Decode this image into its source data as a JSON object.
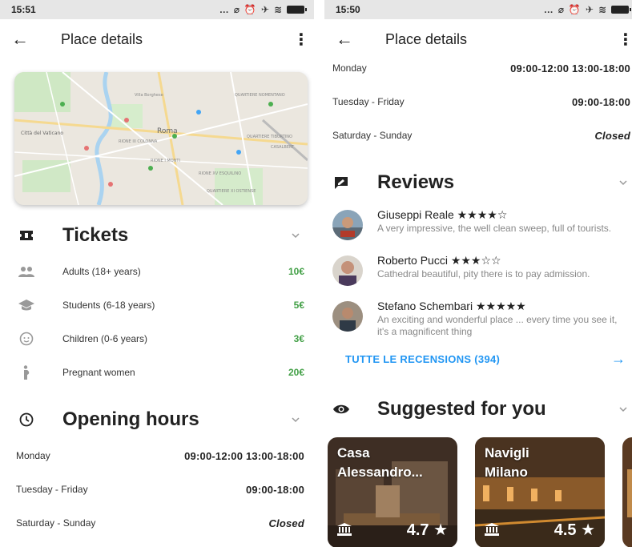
{
  "left": {
    "status_time": "15:51",
    "title": "Place details",
    "tickets": {
      "title": "Tickets",
      "rows": [
        {
          "label": "Adults (18+ years)",
          "price": "10€"
        },
        {
          "label": "Students (6-18 years)",
          "price": "5€"
        },
        {
          "label": "Children (0-6 years)",
          "price": "3€"
        },
        {
          "label": "Pregnant women",
          "price": "20€"
        }
      ]
    },
    "hours": {
      "title": "Opening hours",
      "rows": [
        {
          "day": "Monday",
          "time": "09:00-12:00 13:00-18:00"
        },
        {
          "day": "Tuesday - Friday",
          "time": "09:00-18:00"
        },
        {
          "day": "Saturday - Sunday",
          "time": "Closed"
        }
      ]
    },
    "map_labels": [
      "Roma",
      "Città del Vaticano",
      "QUARTIERE XI OSTIENSE",
      "RIONE I MONTI",
      "CASALBERT",
      "QUARTIERE NOMENTANO",
      "QUARTIERE TIBURTINO",
      "RIONE XV ESQUILINO",
      "RIONE III COLONNA",
      "Villa Borghese"
    ]
  },
  "right": {
    "status_time": "15:50",
    "title": "Place details",
    "hours": [
      {
        "day": "Monday",
        "time": "09:00-12:00 13:00-18:00"
      },
      {
        "day": "Tuesday - Friday",
        "time": "09:00-18:00"
      },
      {
        "day": "Saturday - Sunday",
        "time": "Closed"
      }
    ],
    "reviews": {
      "title": "Reviews",
      "items": [
        {
          "name": "Giuseppi Reale",
          "stars": "★★★★☆",
          "text": "A very impressive, the well clean sweep, full of tourists."
        },
        {
          "name": "Roberto Pucci",
          "stars": "★★★☆☆",
          "text": "Cathedral beautiful, pity there is to pay admission."
        },
        {
          "name": "Stefano Schembari",
          "stars": "★★★★★",
          "text": "An exciting and wonderful place ... every time you see it, it's a magnificent thing"
        }
      ],
      "all_link": "TUTTE LE RECENSIONS (394)",
      "arrow": "→"
    },
    "suggested": {
      "title": "Suggested for you",
      "cards": [
        {
          "name_line1": "Casa",
          "name_line2": "Alessandro...",
          "rating": "4.7 ★"
        },
        {
          "name_line1": "Navigli",
          "name_line2": "Milano",
          "rating": "4.5 ★"
        }
      ]
    }
  },
  "colors": {
    "accent": "#2196f3",
    "price": "#43a047",
    "status_bar": "#e6e6e6"
  }
}
